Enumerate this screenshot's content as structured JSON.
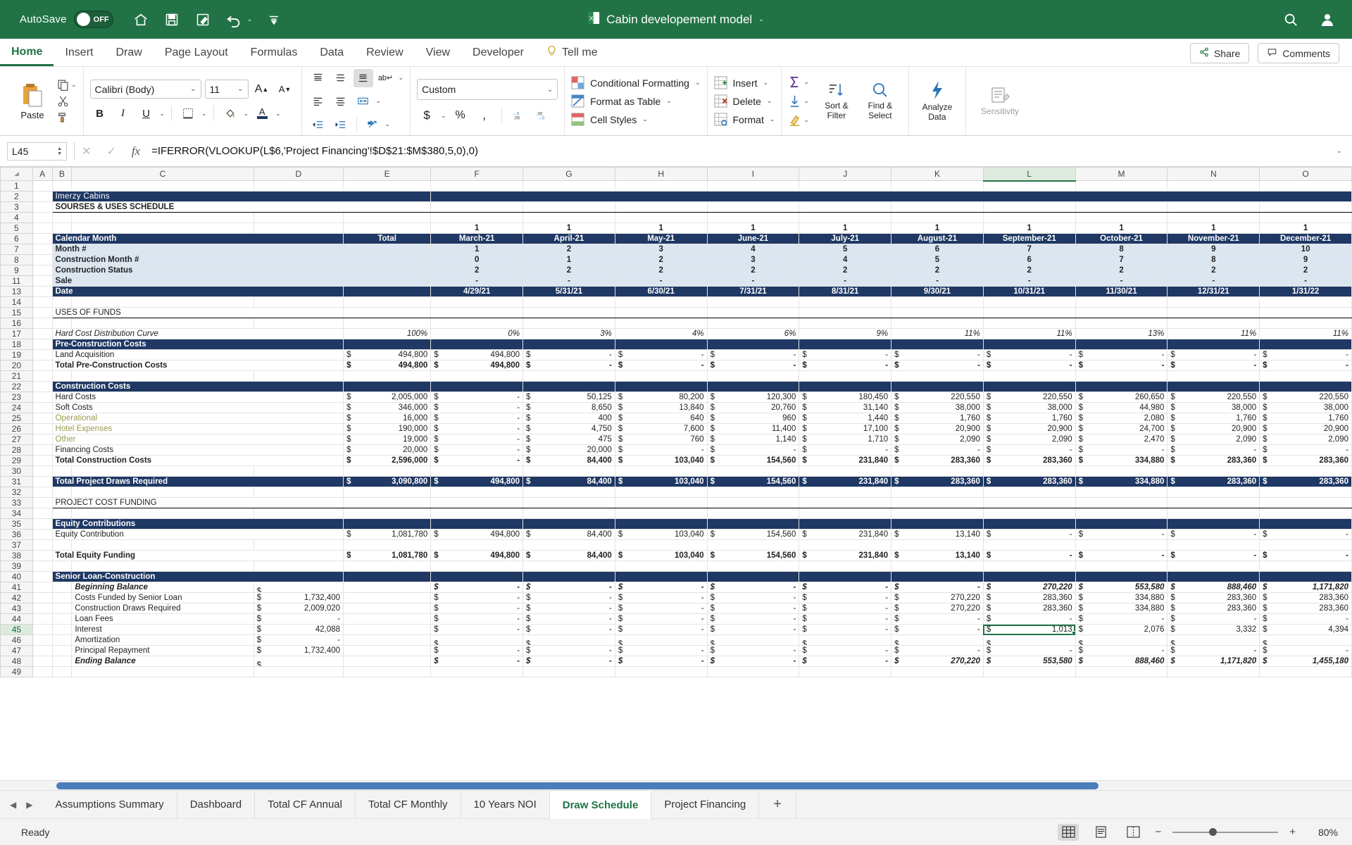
{
  "titlebar": {
    "autosave_label": "AutoSave",
    "autosave_state": "OFF",
    "document_title": "Cabin developement model",
    "qat": [
      "home-icon",
      "save-icon",
      "save-edit-icon",
      "undo-icon",
      "undo-dropdown-icon",
      "customize-qat-icon"
    ],
    "search_icon": "search-icon",
    "account_icon": "account-icon",
    "brand_color": "#217346"
  },
  "ribbon_tabs": [
    {
      "label": "Home",
      "active": true
    },
    {
      "label": "Insert",
      "active": false
    },
    {
      "label": "Draw",
      "active": false
    },
    {
      "label": "Page Layout",
      "active": false
    },
    {
      "label": "Formulas",
      "active": false
    },
    {
      "label": "Data",
      "active": false
    },
    {
      "label": "Review",
      "active": false
    },
    {
      "label": "View",
      "active": false
    },
    {
      "label": "Developer",
      "active": false
    },
    {
      "label": "Tell me",
      "active": false
    }
  ],
  "ribbon_right": {
    "share_label": "Share",
    "comments_label": "Comments"
  },
  "ribbon": {
    "paste_label": "Paste",
    "font_name": "Calibri (Body)",
    "font_size": "11",
    "bold": "B",
    "italic": "I",
    "underline": "U",
    "number_format": "Custom",
    "styles": [
      {
        "label": "Conditional Formatting"
      },
      {
        "label": "Format as Table"
      },
      {
        "label": "Cell Styles"
      }
    ],
    "cells": [
      {
        "label": "Insert"
      },
      {
        "label": "Delete"
      },
      {
        "label": "Format"
      }
    ],
    "editing": [
      {
        "label": "Sort &\nFilter",
        "line1": "Sort &",
        "line2": "Filter"
      },
      {
        "label": "Find &\nSelect",
        "line1": "Find &",
        "line2": "Select"
      }
    ],
    "analyze_line1": "Analyze",
    "analyze_line2": "Data",
    "sensitivity_label": "Sensitivity"
  },
  "formula_bar": {
    "name_box": "L45",
    "cancel_icon": "cancel-icon",
    "confirm_icon": "confirm-icon",
    "function_icon": "fx-icon",
    "formula": "=IFERROR(VLOOKUP(L$6,'Project Financing'!$D$21:$M$380,5,0),0)"
  },
  "grid": {
    "columns": [
      "A",
      "B",
      "C",
      "D",
      "E",
      "F",
      "G",
      "H",
      "I",
      "J",
      "K",
      "L",
      "M",
      "N",
      "O"
    ],
    "selected_column": "L",
    "selected_row": "45",
    "selected_cell": "L45",
    "row_numbers": [
      "1",
      "2",
      "3",
      "4",
      "5",
      "6",
      "7",
      "8",
      "9",
      "11",
      "13",
      "14",
      "15",
      "16",
      "17",
      "18",
      "19",
      "20",
      "21",
      "22",
      "23",
      "24",
      "25",
      "26",
      "27",
      "28",
      "29",
      "30",
      "31",
      "32",
      "33",
      "34",
      "35",
      "36",
      "37",
      "38",
      "39",
      "40",
      "41",
      "42",
      "43",
      "44",
      "45",
      "46",
      "47",
      "48",
      "49"
    ],
    "sheet_title": "Imerzy Cabins",
    "sheet_subtitle": "SOURSES & USES SCHEDULE",
    "period_labels": [
      "Total",
      "March-21",
      "April-21",
      "May-21",
      "June-21",
      "July-21",
      "August-21",
      "September-21",
      "October-21",
      "November-21",
      "December-21"
    ],
    "ones_row": [
      "",
      "1",
      "1",
      "1",
      "1",
      "1",
      "1",
      "1",
      "1",
      "1",
      "1"
    ],
    "rows": [
      {
        "num": "1",
        "type": "blank"
      },
      {
        "num": "2",
        "type": "title",
        "label": "Imerzy Cabins"
      },
      {
        "num": "3",
        "type": "subtitle",
        "label": "SOURSES & USES SCHEDULE"
      },
      {
        "num": "4",
        "type": "blank"
      },
      {
        "num": "5",
        "type": "ones",
        "label": "",
        "values": [
          "",
          "1",
          "1",
          "1",
          "1",
          "1",
          "1",
          "1",
          "1",
          "1",
          "1"
        ]
      },
      {
        "num": "6",
        "type": "header",
        "label": "Calendar Month",
        "values": [
          "Total",
          "March-21",
          "April-21",
          "May-21",
          "June-21",
          "July-21",
          "August-21",
          "September-21",
          "October-21",
          "November-21",
          "December-21"
        ]
      },
      {
        "num": "7",
        "type": "lblue",
        "label": "Month #",
        "values": [
          "",
          "1",
          "2",
          "3",
          "4",
          "5",
          "6",
          "7",
          "8",
          "9",
          "10"
        ]
      },
      {
        "num": "8",
        "type": "lblue",
        "label": "Construction Month #",
        "values": [
          "",
          "0",
          "1",
          "2",
          "3",
          "4",
          "5",
          "6",
          "7",
          "8",
          "9"
        ]
      },
      {
        "num": "9",
        "type": "lblue",
        "label": "Construction Status",
        "values": [
          "",
          "2",
          "2",
          "2",
          "2",
          "2",
          "2",
          "2",
          "2",
          "2",
          "2"
        ]
      },
      {
        "num": "11",
        "type": "lblue",
        "label": "Sale",
        "values": [
          "",
          "-",
          "-",
          "-",
          "-",
          "-",
          "-",
          "-",
          "-",
          "-",
          "-"
        ]
      },
      {
        "num": "13",
        "type": "header",
        "label": "Date",
        "values": [
          "",
          "4/29/21",
          "5/31/21",
          "6/30/21",
          "7/31/21",
          "8/31/21",
          "9/30/21",
          "10/31/21",
          "11/30/21",
          "12/31/21",
          "1/31/22"
        ]
      },
      {
        "num": "14",
        "type": "blank"
      },
      {
        "num": "15",
        "type": "section",
        "label": "USES OF FUNDS"
      },
      {
        "num": "16",
        "type": "blank"
      },
      {
        "num": "17",
        "type": "pct",
        "label": "Hard Cost Distribution Curve",
        "values": [
          "100%",
          "0%",
          "3%",
          "4%",
          "6%",
          "9%",
          "11%",
          "11%",
          "13%",
          "11%",
          "11%"
        ]
      },
      {
        "num": "18",
        "type": "navyband",
        "label": "Pre-Construction Costs"
      },
      {
        "num": "19",
        "type": "money",
        "label": "Land Acquisition",
        "values": [
          "494,800",
          "494,800",
          "-",
          "-",
          "-",
          "-",
          "-",
          "-",
          "-",
          "-",
          "-"
        ]
      },
      {
        "num": "20",
        "type": "moneytot",
        "label": "Total Pre-Construction Costs",
        "values": [
          "494,800",
          "494,800",
          "-",
          "-",
          "-",
          "-",
          "-",
          "-",
          "-",
          "-",
          "-"
        ]
      },
      {
        "num": "21",
        "type": "blank"
      },
      {
        "num": "22",
        "type": "navyband",
        "label": "Construction Costs"
      },
      {
        "num": "23",
        "type": "money",
        "label": "Hard Costs",
        "values": [
          "2,005,000",
          "-",
          "50,125",
          "80,200",
          "120,300",
          "180,450",
          "220,550",
          "220,550",
          "260,650",
          "220,550",
          "220,550"
        ]
      },
      {
        "num": "24",
        "type": "money",
        "label": "Soft Costs",
        "values": [
          "346,000",
          "-",
          "8,650",
          "13,840",
          "20,760",
          "31,140",
          "38,000",
          "38,000",
          "44,980",
          "38,000",
          "38,000"
        ]
      },
      {
        "num": "25",
        "type": "money",
        "label": "Operational",
        "style": "olive",
        "values": [
          "16,000",
          "-",
          "400",
          "640",
          "960",
          "1,440",
          "1,760",
          "1,760",
          "2,080",
          "1,760",
          "1,760"
        ]
      },
      {
        "num": "26",
        "type": "money",
        "label": "Hotel Expenses",
        "style": "olive",
        "values": [
          "190,000",
          "-",
          "4,750",
          "7,600",
          "11,400",
          "17,100",
          "20,900",
          "20,900",
          "24,700",
          "20,900",
          "20,900"
        ]
      },
      {
        "num": "27",
        "type": "money",
        "label": "Other",
        "style": "olive",
        "values": [
          "19,000",
          "-",
          "475",
          "760",
          "1,140",
          "1,710",
          "2,090",
          "2,090",
          "2,470",
          "2,090",
          "2,090"
        ]
      },
      {
        "num": "28",
        "type": "money",
        "label": "Financing Costs",
        "values": [
          "20,000",
          "-",
          "20,000",
          "-",
          "-",
          "-",
          "-",
          "-",
          "-",
          "-",
          "-"
        ]
      },
      {
        "num": "29",
        "type": "moneytot",
        "label": "Total Construction Costs",
        "values": [
          "2,596,000",
          "-",
          "84,400",
          "103,040",
          "154,560",
          "231,840",
          "283,360",
          "283,360",
          "334,880",
          "283,360",
          "283,360"
        ]
      },
      {
        "num": "30",
        "type": "blank"
      },
      {
        "num": "31",
        "type": "navytot",
        "label": "Total Project Draws Required",
        "values": [
          "3,090,800",
          "494,800",
          "84,400",
          "103,040",
          "154,560",
          "231,840",
          "283,360",
          "283,360",
          "334,880",
          "283,360",
          "283,360"
        ]
      },
      {
        "num": "32",
        "type": "blank"
      },
      {
        "num": "33",
        "type": "section",
        "label": "PROJECT COST FUNDING"
      },
      {
        "num": "34",
        "type": "blank"
      },
      {
        "num": "35",
        "type": "navyband",
        "label": "Equity Contributions"
      },
      {
        "num": "36",
        "type": "money",
        "label": "Equity Contribution",
        "values": [
          "1,081,780",
          "494,800",
          "84,400",
          "103,040",
          "154,560",
          "231,840",
          "13,140",
          "-",
          "-",
          "-",
          "-"
        ]
      },
      {
        "num": "37",
        "type": "blank"
      },
      {
        "num": "38",
        "type": "moneytot",
        "label": "Total Equity Funding",
        "values": [
          "1,081,780",
          "494,800",
          "84,400",
          "103,040",
          "154,560",
          "231,840",
          "13,140",
          "-",
          "-",
          "-",
          "-"
        ]
      },
      {
        "num": "39",
        "type": "blank"
      },
      {
        "num": "40",
        "type": "navyband",
        "label": "Senior Loan-Construction"
      },
      {
        "num": "41",
        "type": "moneyD",
        "label": "Beginning Balance",
        "style": "it",
        "values": [
          "",
          "-",
          "-",
          "-",
          "-",
          "-",
          "-",
          "270,220",
          "553,580",
          "888,460",
          "1,171,820"
        ]
      },
      {
        "num": "42",
        "type": "moneyD",
        "label": "Costs Funded by Senior Loan",
        "dval": "1,732,400",
        "values": [
          "",
          "-",
          "-",
          "-",
          "-",
          "-",
          "270,220",
          "283,360",
          "334,880",
          "283,360",
          "283,360"
        ]
      },
      {
        "num": "43",
        "type": "moneyD",
        "label": "Construction Draws Required",
        "dval": "2,009,020",
        "values": [
          "",
          "-",
          "-",
          "-",
          "-",
          "-",
          "270,220",
          "283,360",
          "334,880",
          "283,360",
          "283,360"
        ]
      },
      {
        "num": "44",
        "type": "moneyD",
        "label": "Loan Fees",
        "dval": "-",
        "values": [
          "",
          "-",
          "-",
          "-",
          "-",
          "-",
          "-",
          "-",
          "-",
          "-",
          "-"
        ]
      },
      {
        "num": "45",
        "type": "moneyD",
        "label": "Interest",
        "dval": "42,088",
        "values": [
          "",
          "-",
          "-",
          "-",
          "-",
          "-",
          "-",
          "1,013",
          "2,076",
          "3,332",
          "4,394"
        ]
      },
      {
        "num": "46",
        "type": "moneyD",
        "label": "Amortization",
        "dval": "-",
        "values": [
          "",
          "",
          "",
          "",
          "",
          "",
          "",
          "",
          "",
          "",
          ""
        ]
      },
      {
        "num": "47",
        "type": "moneyD",
        "label": "Principal Repayment",
        "dval": "1,732,400",
        "values": [
          "",
          "-",
          "-",
          "-",
          "-",
          "-",
          "-",
          "-",
          "-",
          "-",
          "-"
        ]
      },
      {
        "num": "48",
        "type": "moneyD",
        "label": "Ending Balance",
        "style": "it",
        "values": [
          "",
          "-",
          "-",
          "-",
          "-",
          "-",
          "270,220",
          "553,580",
          "888,460",
          "1,171,820",
          "1,455,180"
        ]
      },
      {
        "num": "49",
        "type": "blank"
      }
    ]
  },
  "sheet_tabs": [
    {
      "label": "Assumptions Summary",
      "active": false
    },
    {
      "label": "Dashboard",
      "active": false
    },
    {
      "label": "Total CF Annual",
      "active": false
    },
    {
      "label": "Total CF Monthly",
      "active": false
    },
    {
      "label": "10 Years NOI",
      "active": false
    },
    {
      "label": "Draw Schedule",
      "active": true
    },
    {
      "label": "Project Financing",
      "active": false
    }
  ],
  "sheet_tabs_add": "+",
  "status_bar": {
    "status_text": "Ready",
    "zoom_level": "80%",
    "zoom_out": "−",
    "zoom_in": "+",
    "views": [
      "normal-view-icon",
      "page-layout-icon",
      "page-break-icon"
    ]
  }
}
